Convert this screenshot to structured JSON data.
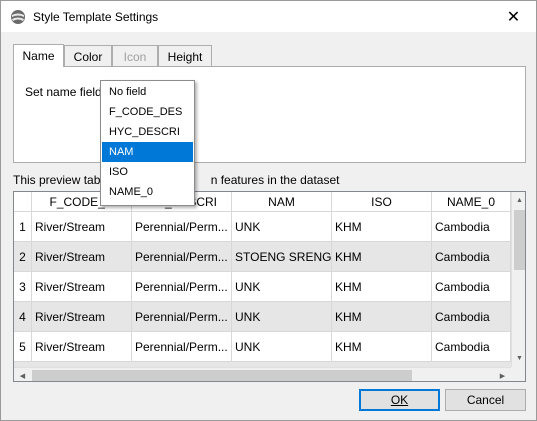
{
  "window": {
    "title": "Style Template Settings",
    "close_glyph": "✕"
  },
  "tabs": [
    {
      "label": "Name",
      "active": true,
      "disabled": false
    },
    {
      "label": "Color",
      "active": false,
      "disabled": false
    },
    {
      "label": "Icon",
      "active": false,
      "disabled": true
    },
    {
      "label": "Height",
      "active": false,
      "disabled": false
    }
  ],
  "name_tab": {
    "set_name_field_label": "Set name field"
  },
  "dropdown": {
    "options": [
      "No field",
      "F_CODE_DES",
      "HYC_DESCRI",
      "NAM",
      "ISO",
      "NAME_0"
    ],
    "selected_index": 3
  },
  "preview": {
    "text_before": "This preview table",
    "text_after": "n features in the dataset"
  },
  "table": {
    "columns": [
      "F_CODE_DES",
      "HYC_DESCRI",
      "NAM",
      "ISO",
      "NAME_0"
    ],
    "visible_headers": [
      "F_CODE_D",
      "_DESCRI",
      "NAM",
      "ISO",
      "NAME_0"
    ],
    "rows": [
      {
        "num": "1",
        "cells": [
          "River/Stream",
          "Perennial/Perm...",
          "UNK",
          "KHM",
          "Cambodia"
        ]
      },
      {
        "num": "2",
        "cells": [
          "River/Stream",
          "Perennial/Perm...",
          "STOENG SRENG",
          "KHM",
          "Cambodia"
        ]
      },
      {
        "num": "3",
        "cells": [
          "River/Stream",
          "Perennial/Perm...",
          "UNK",
          "KHM",
          "Cambodia"
        ]
      },
      {
        "num": "4",
        "cells": [
          "River/Stream",
          "Perennial/Perm...",
          "UNK",
          "KHM",
          "Cambodia"
        ]
      },
      {
        "num": "5",
        "cells": [
          "River/Stream",
          "Perennial/Perm...",
          "UNK",
          "KHM",
          "Cambodia"
        ]
      }
    ]
  },
  "buttons": {
    "ok_label": "OK",
    "cancel_label": "Cancel"
  },
  "colors": {
    "selection": "#0078d7",
    "alt_row": "#e6e6e6"
  }
}
